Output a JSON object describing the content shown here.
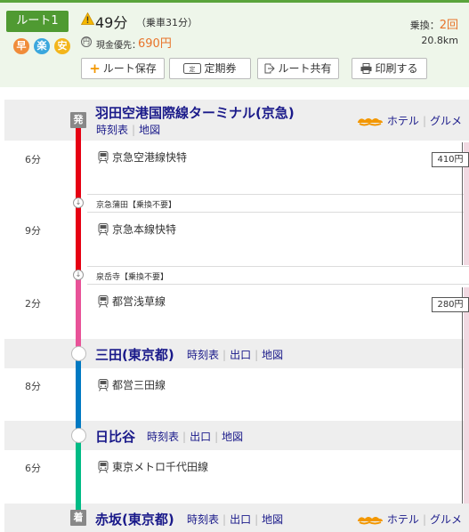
{
  "summary": {
    "route_label": "ルート1",
    "badges": [
      {
        "char": "早",
        "color": "#f08c3a"
      },
      {
        "char": "楽",
        "color": "#3aa7dd"
      },
      {
        "char": "安",
        "color": "#f3b51b"
      }
    ],
    "duration": "49分",
    "ride_time": "（乗車31分）",
    "cash_icon": "円",
    "cash_label": "現金優先：",
    "fare": "690円",
    "transfer_label": "乗換：",
    "transfer_count": "2回",
    "distance": "20.8km"
  },
  "actions": [
    {
      "label": "ルート保存",
      "icon": "plus-icon"
    },
    {
      "label": "定期券",
      "icon": "commuter-pass-icon"
    },
    {
      "label": "ルート共有",
      "icon": "share-icon"
    },
    {
      "label": "印刷する",
      "icon": "printer-icon"
    }
  ],
  "stations": [
    {
      "tag": "発",
      "name": "羽田空港国際線ターミナル(京急)",
      "links": [
        "時刻表",
        "地図"
      ],
      "extras": [
        "ホテル",
        "グルメ"
      ]
    },
    {
      "name": "三田(東京都)",
      "links": [
        "時刻表",
        "出口",
        "地図"
      ]
    },
    {
      "name": "日比谷",
      "links": [
        "時刻表",
        "出口",
        "地図"
      ]
    },
    {
      "tag": "着",
      "name": "赤坂(東京都)",
      "links": [
        "時刻表",
        "出口",
        "地図"
      ],
      "extras": [
        "ホテル",
        "グルメ"
      ]
    }
  ],
  "segments": [
    {
      "minutes": "6分",
      "line": "京急空港線快特",
      "color": "#e60012"
    },
    {
      "minutes": "9分",
      "line": "京急本線快特",
      "color": "#e60012"
    },
    {
      "minutes": "2分",
      "line": "都営浅草線",
      "color": "#e85298"
    },
    {
      "minutes": "8分",
      "line": "都営三田線",
      "color": "#0079c2"
    },
    {
      "minutes": "6分",
      "line": "東京メトロ千代田線",
      "color": "#00bb85"
    }
  ],
  "transfers": [
    {
      "note": "京急蒲田【乗換不要】"
    },
    {
      "note": "泉岳寺【乗換不要】"
    }
  ],
  "fares": [
    "410円",
    "280円"
  ],
  "colors": {
    "accent_green": "#4f9a32",
    "link": "#1a1a8a",
    "orange": "#e8742a"
  }
}
